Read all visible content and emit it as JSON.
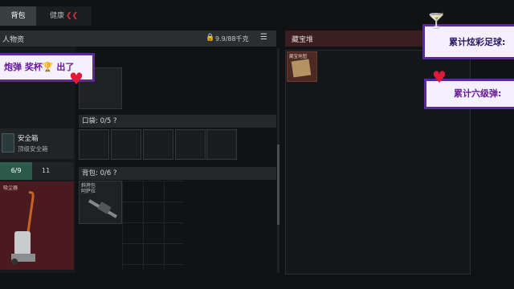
{
  "tabs": {
    "bag": "背包",
    "health": "健康",
    "health_alert": "❮❮"
  },
  "left_header": {
    "title": "人物资",
    "weight": "9.9/88千克"
  },
  "section1": {
    "label": "? "
  },
  "safe_box": {
    "name": "安全箱",
    "desc": "顶级安全箱"
  },
  "counters": {
    "left": "6/9",
    "right": "11"
  },
  "vacuum": {
    "label": "吸尘器"
  },
  "pocket": {
    "title": "口袋: 0/5  ?"
  },
  "backpack": {
    "title": "背包: 0/6  ?",
    "item": "斜挎包\n阿萨拉"
  },
  "stash": {
    "title": "藏宝堆",
    "item": "藏宝地图"
  },
  "banners": {
    "b1": "炮弹 奖杯🏆  出了",
    "b2": "累计炫彩足球:",
    "b3": "累计六级弹:"
  },
  "colors": {
    "accent_red": "#e01b3a",
    "banner_border": "#5a2a9a",
    "safe_green": "#2d5a4a"
  }
}
